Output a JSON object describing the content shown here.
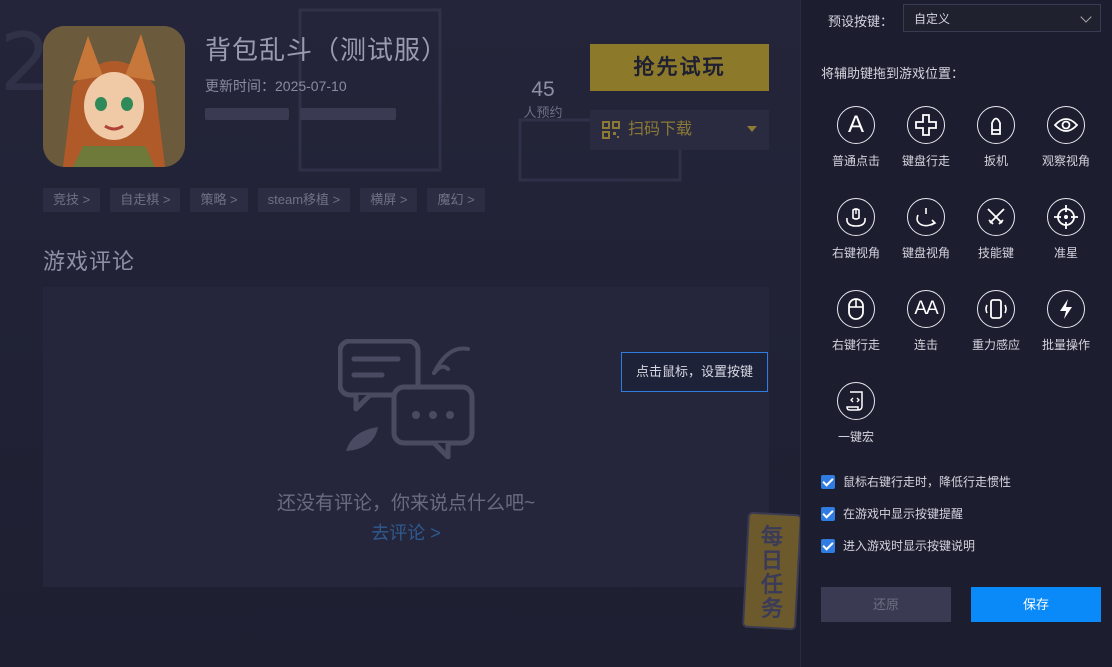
{
  "game": {
    "title": "背包乱斗（测试服）",
    "update_time": "更新时间：2025-07-10",
    "reserve_count": "45",
    "reserve_label": "人预约",
    "play_button": "抢先试玩",
    "scan_button": "扫码下载",
    "tags": [
      "竞技 >",
      "自走棋 >",
      "策略 >",
      "steam移植 >",
      "横屏 >",
      "魔幻 >"
    ]
  },
  "comments": {
    "section_title": "游戏评论",
    "empty_text": "还没有评论，你来说点什么吧~",
    "empty_link": "去评论 >"
  },
  "tooltip": "点击鼠标，设置按键",
  "badge_text": "每日任务",
  "keymap": {
    "preset_label": "预设按键：",
    "preset_value": "自定义",
    "drag_hint": "将辅助键拖到游戏位置：",
    "keys": [
      {
        "label": "普通点击",
        "icon": "letter-a-icon"
      },
      {
        "label": "键盘行走",
        "icon": "dpad-icon"
      },
      {
        "label": "扳机",
        "icon": "bullet-icon"
      },
      {
        "label": "观察视角",
        "icon": "eye-icon"
      },
      {
        "label": "右键视角",
        "icon": "mouse-rotate-icon"
      },
      {
        "label": "键盘视角",
        "icon": "rotate-view-icon"
      },
      {
        "label": "技能键",
        "icon": "crossed-swords-icon"
      },
      {
        "label": "准星",
        "icon": "crosshair-icon"
      },
      {
        "label": "右键行走",
        "icon": "mouse-icon"
      },
      {
        "label": "连击",
        "icon": "double-a-icon"
      },
      {
        "label": "重力感应",
        "icon": "phone-shake-icon"
      },
      {
        "label": "批量操作",
        "icon": "lightning-icon"
      },
      {
        "label": "一键宏",
        "icon": "script-icon"
      }
    ],
    "options": [
      "鼠标右键行走时，降低行走惯性",
      "在游戏中显示按键提醒",
      "进入游戏时显示按键说明"
    ],
    "reset_button": "还原",
    "save_button": "保存"
  }
}
